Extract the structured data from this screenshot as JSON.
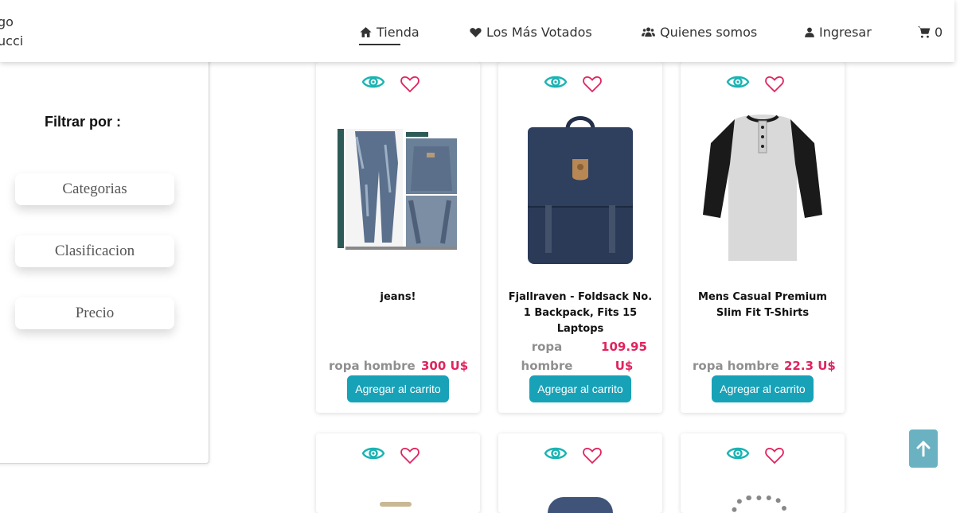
{
  "header": {
    "brand_line1": "go",
    "brand_line2": "ucci",
    "nav": [
      {
        "label": "Tienda",
        "icon": "home-icon"
      },
      {
        "label": "Los Más Votados",
        "icon": "heart-icon"
      },
      {
        "label": "Quienes somos",
        "icon": "users-icon"
      },
      {
        "label": "Ingresar",
        "icon": "user-icon"
      },
      {
        "label": "0",
        "icon": "cart-icon"
      }
    ]
  },
  "sidebar": {
    "title": "Filtrar por :",
    "filters": [
      "Categorias",
      "Clasificacion",
      "Precio"
    ]
  },
  "products": [
    {
      "title": "jeans!",
      "category": "ropa hombre",
      "price": "300 U$",
      "image": "jeans"
    },
    {
      "title": "Fjallraven - Foldsack No. 1 Backpack, Fits 15 Laptops",
      "category": "ropa hombre",
      "price": "109.95 U$",
      "image": "backpack"
    },
    {
      "title": "Mens Casual Premium Slim Fit T-Shirts",
      "category": "ropa hombre",
      "price": "22.3 U$",
      "image": "tshirt"
    }
  ],
  "add_to_cart_label": "Agregar al carrito",
  "colors": {
    "accent": "#17a2b8",
    "price": "#e0245e",
    "eye": "#1ab3b3",
    "heart": "#e0245e"
  }
}
